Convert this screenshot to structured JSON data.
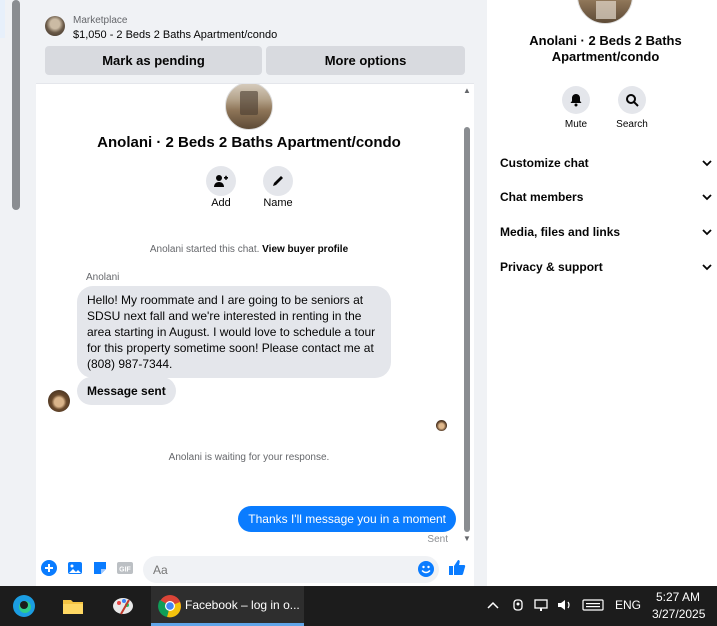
{
  "marketplace": {
    "label": "Marketplace",
    "price_listing": "$1,050 - 2 Beds 2 Baths Apartment/condo",
    "mark_pending_label": "Mark as pending",
    "more_options_label": "More options"
  },
  "thread": {
    "title": "Anolani · 2 Beds 2 Baths Apartment/condo",
    "add_label": "Add",
    "name_label": "Name",
    "started_text": "Anolani started this chat.",
    "view_profile_label": "View buyer profile",
    "sender_name": "Anolani",
    "messages": [
      "Hello! My roommate and I are going to be seniors at SDSU next fall and we're interested in renting in the area starting in August. I would love to schedule a tour for this property sometime soon! Please contact me at (808) 987-7344.",
      "Message sent"
    ],
    "waiting_text": "Anolani is waiting for your response.",
    "outgoing_message": "Thanks I'll message you in a moment",
    "sent_status": "Sent"
  },
  "composer": {
    "placeholder": "Aa",
    "icons": [
      "plus-icon",
      "photo-icon",
      "sticker-icon",
      "gif-icon",
      "emoji-icon",
      "like-icon"
    ],
    "gif_label": "GIF"
  },
  "right_panel": {
    "title": "Anolani · 2 Beds 2 Baths Apartment/condo",
    "mute_label": "Mute",
    "search_label": "Search",
    "rows": [
      "Customize chat",
      "Chat members",
      "Media, files and links",
      "Privacy & support"
    ]
  },
  "taskbar": {
    "chrome_label": "Facebook – log in o...",
    "language": "ENG",
    "time": "5:27 AM",
    "date": "3/27/2025"
  },
  "colors": {
    "accent": "#0a7cff",
    "bubble_gray": "#e4e6eb",
    "background": "#f0f2f5",
    "taskbar": "#1c1c1c"
  }
}
